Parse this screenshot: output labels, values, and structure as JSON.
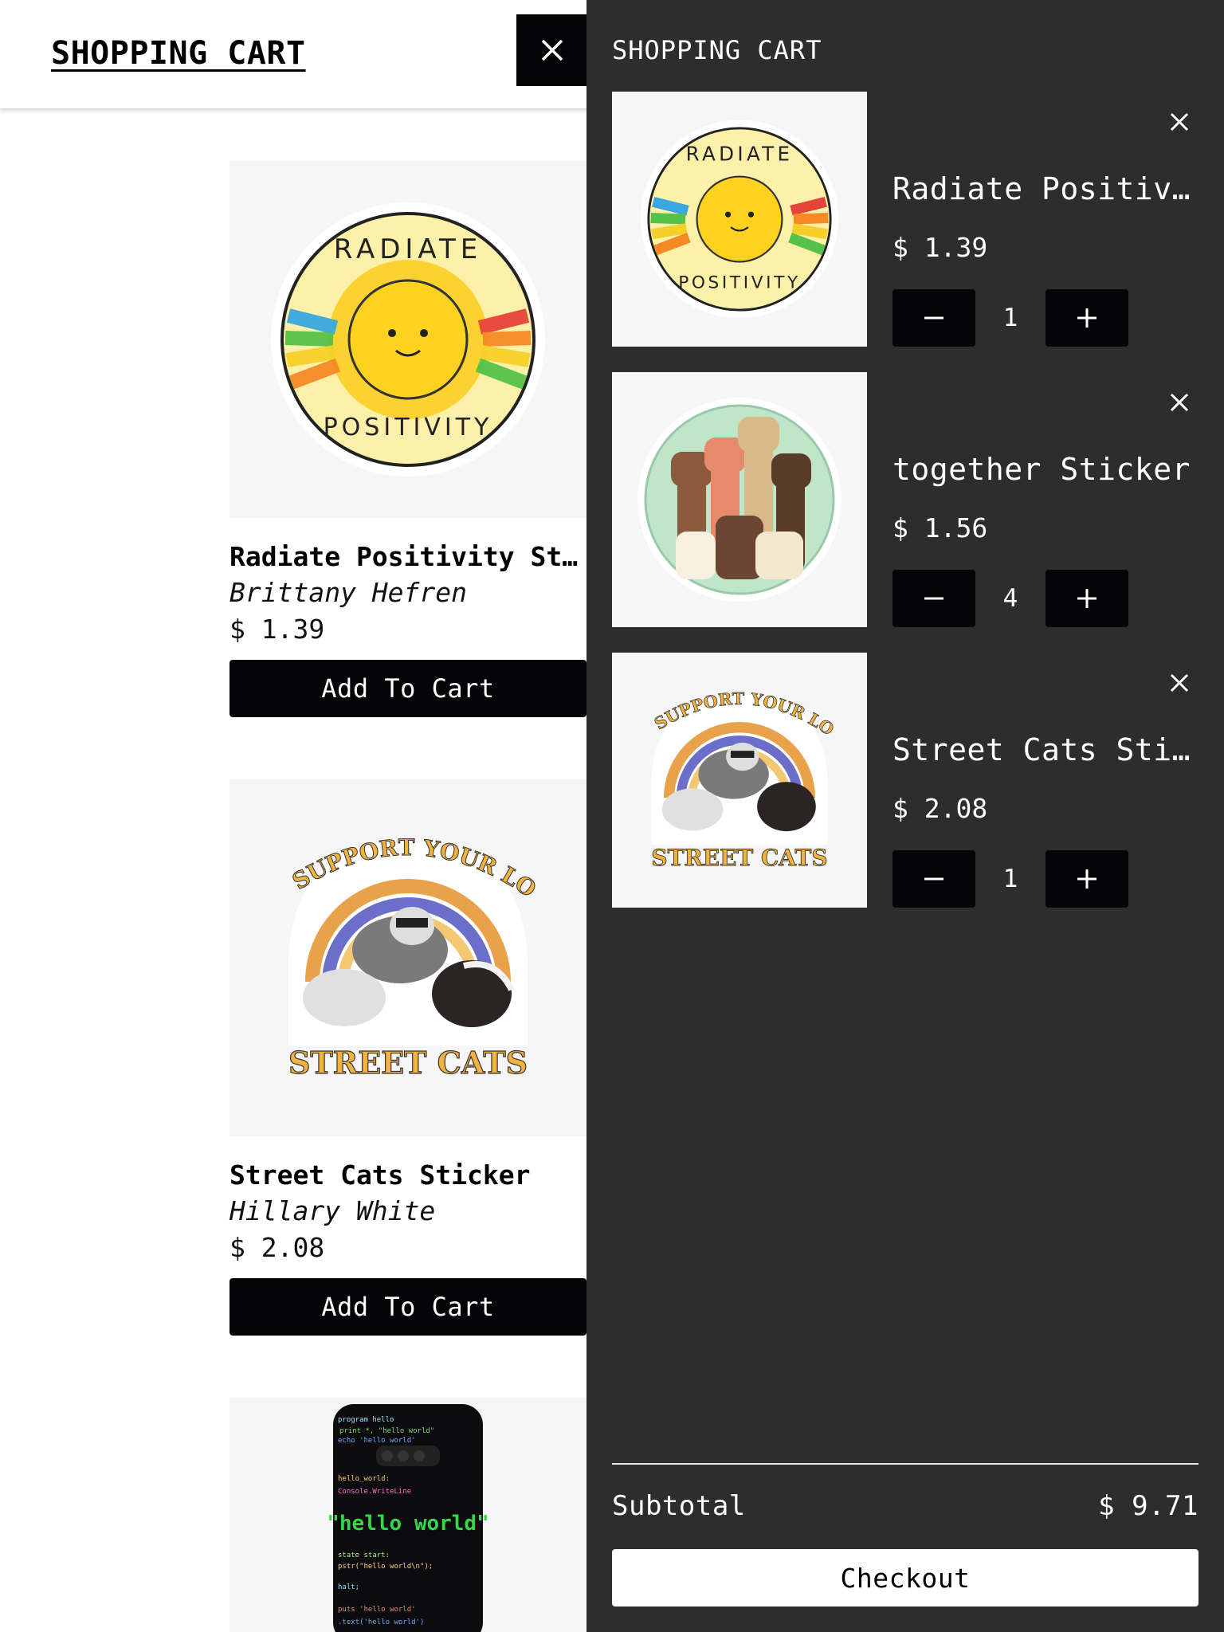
{
  "header": {
    "title": "SHOPPING CART",
    "close_icon": "close-icon"
  },
  "products": [
    {
      "name": "Radiate Positivity Sticker",
      "artist": "Brittany Hefren",
      "price": "$ 1.39",
      "button": "Add To Cart",
      "image": "radiate-positivity-sun-sticker"
    },
    {
      "name": "Street Cats Sticker",
      "artist": "Hillary White",
      "price": "$ 2.08",
      "button": "Add To Cart",
      "image": "street-cats-raccoon-sticker"
    },
    {
      "image": "hello-world-phone-case"
    }
  ],
  "cart": {
    "title": "SHOPPING CART",
    "items": [
      {
        "title": "Radiate Positivity Sticker",
        "price": "$ 1.39",
        "quantity": "1",
        "image": "radiate-positivity-sun-sticker"
      },
      {
        "title": "together Sticker",
        "price": "$ 1.56",
        "quantity": "4",
        "image": "together-fists-sticker"
      },
      {
        "title": "Street Cats Sticker",
        "price": "$ 2.08",
        "quantity": "1",
        "image": "street-cats-raccoon-sticker"
      }
    ],
    "subtotal_label": "Subtotal",
    "subtotal_value": "$ 9.71",
    "checkout_label": "Checkout"
  },
  "colors": {
    "drawer_bg": "#2d2d2e",
    "button_bg": "#050508",
    "image_bg": "#f6f6f6"
  }
}
